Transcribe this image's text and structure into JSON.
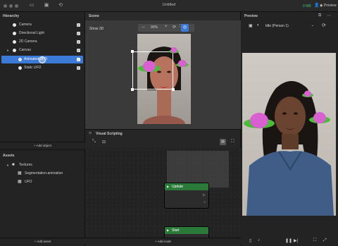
{
  "window": {
    "title": "Untitled",
    "status": "0 MB",
    "preview_label": "Preview"
  },
  "hierarchy": {
    "title": "Hierarchy",
    "items": [
      {
        "label": "Camera",
        "indent": 0
      },
      {
        "label": "Directional Light",
        "indent": 0
      },
      {
        "label": "2D Camera",
        "indent": 0
      },
      {
        "label": "Canvas",
        "indent": 0
      },
      {
        "label": "Animated UFO",
        "indent": 1
      },
      {
        "label": "Static UFO",
        "indent": 1
      }
    ],
    "add_object": "+ Add object"
  },
  "assets": {
    "title": "Assets",
    "items": [
      {
        "label": "Textures"
      },
      {
        "label": "Segmentation-animation"
      },
      {
        "label": "UFO"
      }
    ],
    "add_asset": "+ Add asset"
  },
  "scene": {
    "title": "Scene",
    "show3d": "Show 3D",
    "zoom": "90%",
    "minus": "—",
    "plus": "+"
  },
  "visual_scripting": {
    "title": "Visual Scripting",
    "add_node": "+ Add node",
    "nodes": [
      {
        "label": "Update"
      },
      {
        "label": "Start"
      }
    ]
  },
  "preview": {
    "title": "Preview",
    "effect": "Idle (Person 1)"
  },
  "colors": {
    "accent": "#3c7ad8",
    "node_green": "#2b7a3a",
    "status_green": "#3fc46b"
  }
}
